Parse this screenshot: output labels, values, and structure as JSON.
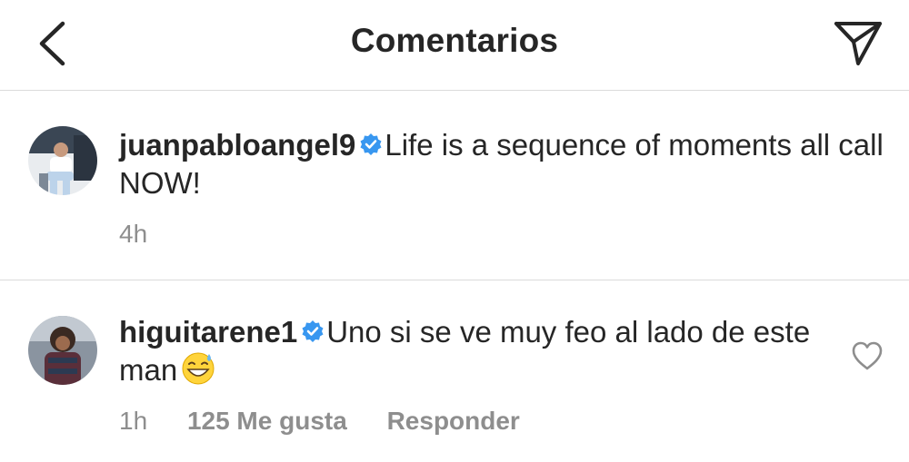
{
  "header": {
    "title": "Comentarios",
    "back_icon": "chevron-left-icon",
    "share_icon": "paper-plane-icon"
  },
  "caption": {
    "username": "juanpabloangel9",
    "verified": true,
    "text": "Life is a sequence of moments all call NOW!",
    "time": "4h"
  },
  "comments": [
    {
      "username": "higuitarene1",
      "verified": true,
      "text": "Uno si se ve muy feo al lado de este man",
      "emoji": "grinning-face-with-sweat",
      "time": "1h",
      "likes": "125 Me gusta",
      "reply_label": "Responder",
      "like_icon": "heart-outline-icon"
    }
  ],
  "colors": {
    "text": "#262626",
    "secondary": "#8e8e8e",
    "verified_blue": "#3897f0",
    "divider": "#dbdbdb"
  }
}
